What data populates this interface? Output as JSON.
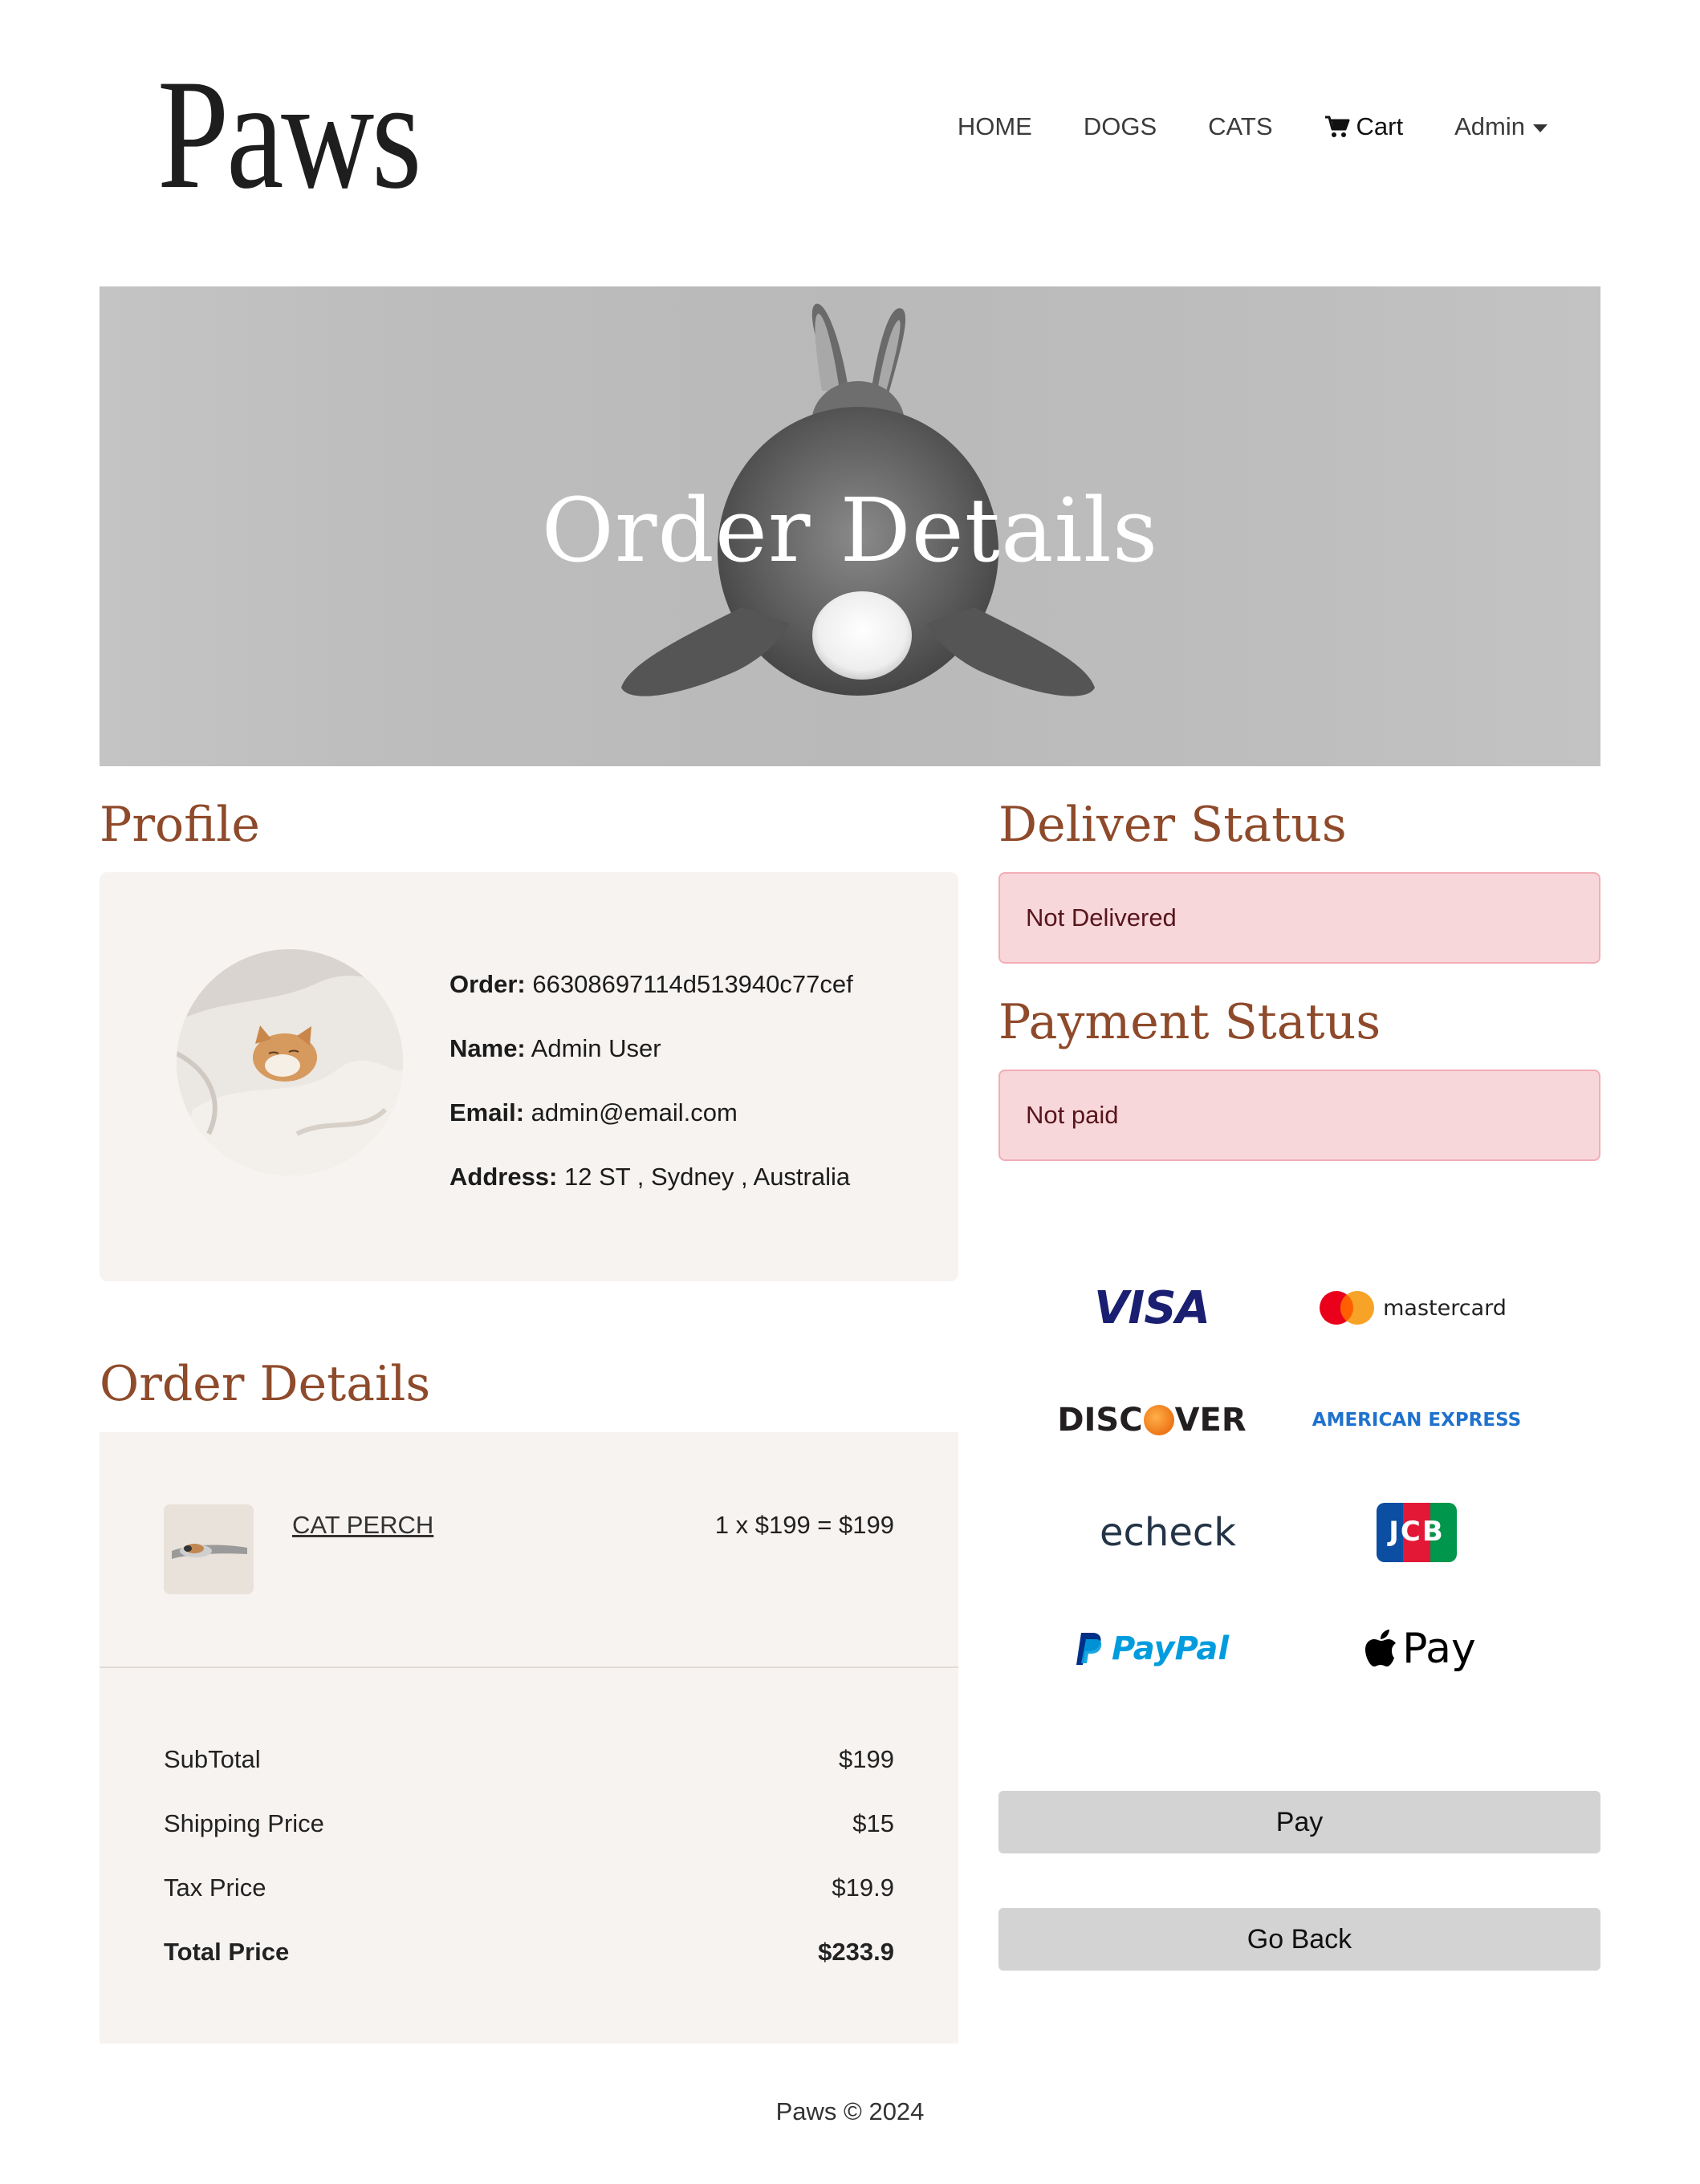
{
  "header": {
    "logo_text": "Paws",
    "nav": {
      "home": "HOME",
      "dogs": "DOGS",
      "cats": "CATS",
      "cart": "Cart",
      "admin": "Admin"
    }
  },
  "hero": {
    "title": "Order Details"
  },
  "profile": {
    "heading": "Profile",
    "order_label": "Order:",
    "order_id": "66308697114d513940c77cef",
    "name_label": "Name:",
    "name": "Admin User",
    "email_label": "Email:",
    "email": "admin@email.com",
    "address_label": "Address:",
    "address": "12 ST , Sydney , Australia"
  },
  "deliver": {
    "heading": "Deliver Status",
    "status": "Not Delivered"
  },
  "payment": {
    "heading": "Payment Status",
    "status": "Not paid"
  },
  "order_details": {
    "heading": "Order Details",
    "items": [
      {
        "name": "CAT PERCH",
        "price_line": "1 x $199 = $199"
      }
    ],
    "summary": {
      "subtotal_label": "SubTotal",
      "subtotal": "$199",
      "shipping_label": "Shipping Price",
      "shipping": "$15",
      "tax_label": "Tax Price",
      "tax": "$19.9",
      "total_label": "Total Price",
      "total": "$233.9"
    }
  },
  "payment_methods": {
    "visa": "VISA",
    "mastercard": "mastercard",
    "discover_a": "DISC",
    "discover_b": "VER",
    "amex": "AMERICAN EXPRESS",
    "echeck": "echeck",
    "jcb": "JCB",
    "paypal": "PayPal",
    "applepay": "Pay"
  },
  "buttons": {
    "pay": "Pay",
    "go_back": "Go Back"
  },
  "footer": {
    "text": "Paws © 2024"
  },
  "colors": {
    "accent": "#8e4a2a",
    "card_bg": "#f7f3f1",
    "alert_bg": "#f8d7da",
    "button_bg": "#d3d3d3"
  }
}
